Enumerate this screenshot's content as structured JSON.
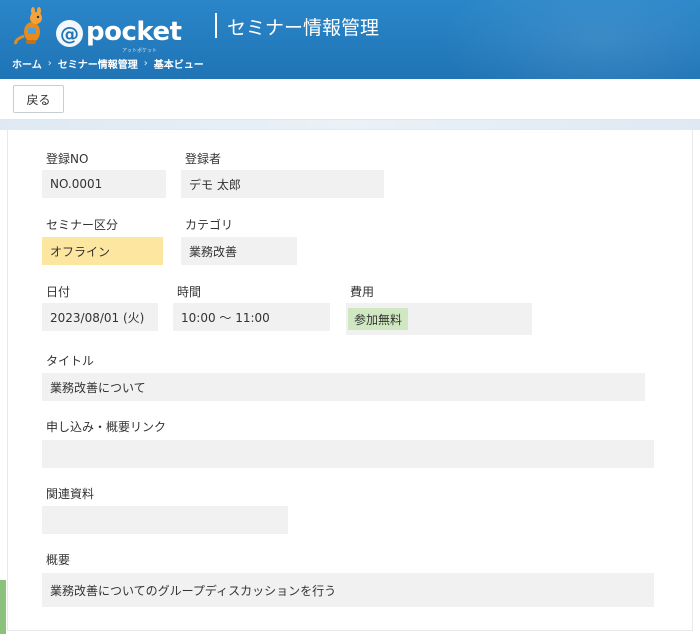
{
  "header": {
    "logo_text": "pocket",
    "logo_at": "@",
    "logo_sub": "アットポケット",
    "page_title": "セミナー情報管理",
    "breadcrumb": [
      "ホーム",
      "セミナー情報管理",
      "基本ビュー"
    ],
    "breadcrumb_separator": "›"
  },
  "toolbar": {
    "back_label": "戻る"
  },
  "form": {
    "reg_no": {
      "label": "登録NO",
      "value": "NO.0001"
    },
    "registrant": {
      "label": "登録者",
      "value": "デモ 太郎"
    },
    "seminar_type": {
      "label": "セミナー区分",
      "value": "オフライン"
    },
    "category": {
      "label": "カテゴリ",
      "value": "業務改善"
    },
    "date": {
      "label": "日付",
      "value": "2023/08/01 (火)"
    },
    "time": {
      "label": "時間",
      "value": "10:00 ～ 11:00"
    },
    "fee": {
      "label": "費用",
      "value": "参加無料"
    },
    "title": {
      "label": "タイトル",
      "value": "業務改善について"
    },
    "link": {
      "label": "申し込み・概要リンク",
      "value": ""
    },
    "materials": {
      "label": "関連資料",
      "value": ""
    },
    "summary": {
      "label": "概要",
      "value": "業務改善についてのグループディスカッションを行う"
    }
  },
  "colors": {
    "header_blue": "#1f74b5",
    "field_bg": "#f1f1f1",
    "offline_badge": "#fde6a0",
    "free_badge": "#cfe8c1"
  }
}
